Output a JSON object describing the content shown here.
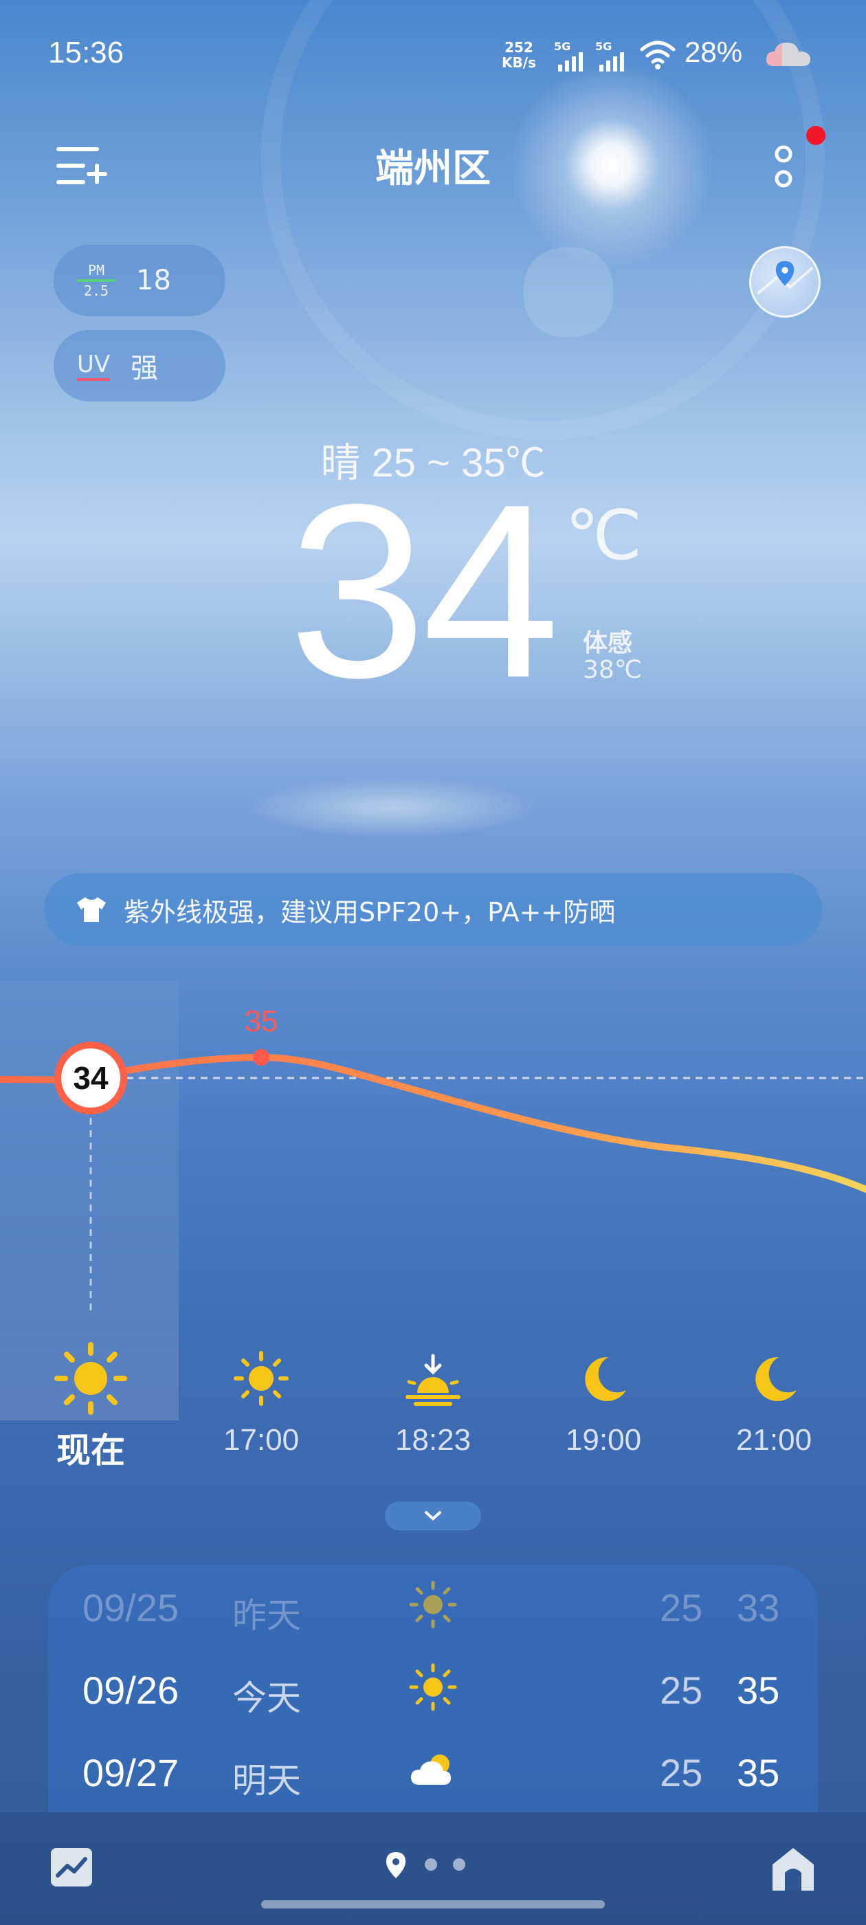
{
  "status_bar": {
    "time": "15:36",
    "net_speed_value": "252",
    "net_speed_unit": "KB/s",
    "signal_1_label": "5G",
    "signal_2_label": "5G",
    "battery": "28%",
    "icons": [
      "signal-icon",
      "wifi-icon",
      "cloud-icon"
    ]
  },
  "header": {
    "city": "端州区",
    "has_notification": true
  },
  "air": {
    "pm_label_top": "PM",
    "pm_label_bottom": "2.5",
    "pm_value": "18",
    "uv_label": "UV",
    "uv_value": "强"
  },
  "current": {
    "condition_range": "晴  25 ~ 35℃",
    "temperature": "34",
    "unit": "℃",
    "feels_label": "体感",
    "feels_value": "38℃"
  },
  "tip": {
    "text": "紫外线极强，建议用SPF20+，PA++防晒"
  },
  "hourly": {
    "current_temp_badge": "34",
    "peak_label": "35",
    "items": [
      {
        "label": "现在",
        "icon": "sun-icon"
      },
      {
        "label": "17:00",
        "icon": "sun-icon"
      },
      {
        "label": "18:23",
        "icon": "sunset-icon"
      },
      {
        "label": "19:00",
        "icon": "moon-icon"
      },
      {
        "label": "21:00",
        "icon": "moon-icon"
      }
    ],
    "temps": [
      34,
      35,
      33,
      31,
      29
    ]
  },
  "daily": [
    {
      "date": "09/25",
      "name": "昨天",
      "icon": "sun-icon",
      "low": "25",
      "high": "33"
    },
    {
      "date": "09/26",
      "name": "今天",
      "icon": "sun-icon",
      "low": "25",
      "high": "35"
    },
    {
      "date": "09/27",
      "name": "明天",
      "icon": "partly-cloudy-icon",
      "low": "25",
      "high": "35"
    }
  ],
  "colors": {
    "accent_red": "#f5182a",
    "curve_start": "#ff6a4a",
    "curve_end": "#f2d45a",
    "sun_yellow": "#f7c518"
  }
}
